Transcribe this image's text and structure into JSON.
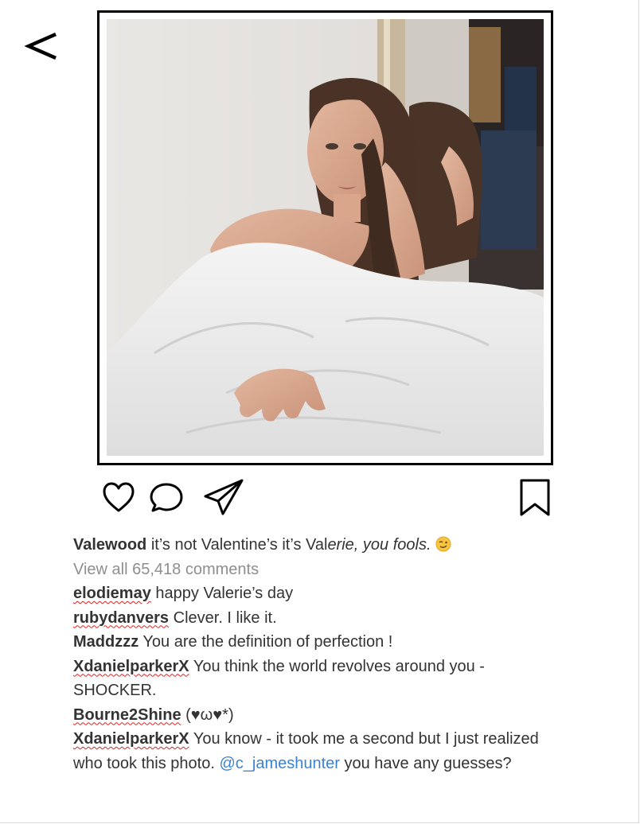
{
  "nav": {
    "back_label": "<"
  },
  "post": {
    "image_alt": "woman wrapped in white blanket sitting by a mirror",
    "caption": {
      "username": "Valewood",
      "text": "it’s not Valentine’s it’s Val",
      "text_italic": "erie, you fools.",
      "emoji": "wink-emoji"
    },
    "view_all": "View all 65,418 comments"
  },
  "actions": {
    "like_icon": "heart-icon",
    "comment_icon": "comment-icon",
    "share_icon": "send-icon",
    "save_icon": "bookmark-icon"
  },
  "comments": [
    {
      "username": "elodiemay",
      "text": "happy Valerie’s day"
    },
    {
      "username": "rubydanvers",
      "text": "Clever. I like it."
    },
    {
      "username": "Maddzzz",
      "text": "You are the definition of perfection !"
    },
    {
      "username": "XdanielparkerX",
      "text": "You think the world revolves around you - SHOCKER."
    },
    {
      "username": "Bourne2Shine",
      "text": "(♥ω♥*)"
    },
    {
      "username": "XdanielparkerX",
      "text_before": "You know - it took me a second but I just realized who took this photo.",
      "mention": "@c_jameshunter",
      "text_after": "you have any guesses?"
    }
  ],
  "colors": {
    "text": "#333333",
    "muted": "#8e8e8e",
    "mention": "#3b82d6",
    "spellcheck": "#e02020"
  }
}
